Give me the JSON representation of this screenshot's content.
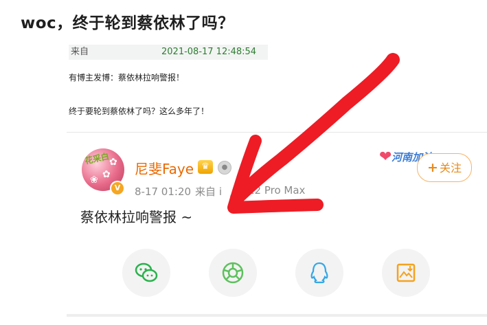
{
  "article": {
    "title": "woc，终于轮到蔡依林了吗？",
    "source_label": "来自",
    "timestamp": "2021-08-17 12:48:54",
    "body_lines": [
      "有博主发博：蔡依林拉响警报！",
      "终于要轮到蔡依林了吗？这么多年了！"
    ]
  },
  "weibo_card": {
    "username": "尼斐Faye",
    "avatar_sticker_text": "花采白",
    "verified_badge": "V",
    "post_date": "8-17 01:20",
    "post_source": "来自 i",
    "post_device": "12 Pro Max",
    "decoration_text": "河南加油",
    "follow_button": {
      "plus": "+",
      "label": "关注"
    },
    "content": "蔡依林拉响警报 ~"
  },
  "share_buttons": [
    {
      "name": "wechat",
      "icon": "wechat-icon",
      "color": "#2ab24c"
    },
    {
      "name": "moments",
      "icon": "moments-icon",
      "color": "#5ec05e"
    },
    {
      "name": "qq",
      "icon": "qq-icon",
      "color": "#35a7e6"
    },
    {
      "name": "save-image",
      "icon": "save-image-icon",
      "color": "#f5a21e"
    }
  ],
  "annotation": {
    "color": "#ee1c25",
    "shape": "red-arrow"
  }
}
